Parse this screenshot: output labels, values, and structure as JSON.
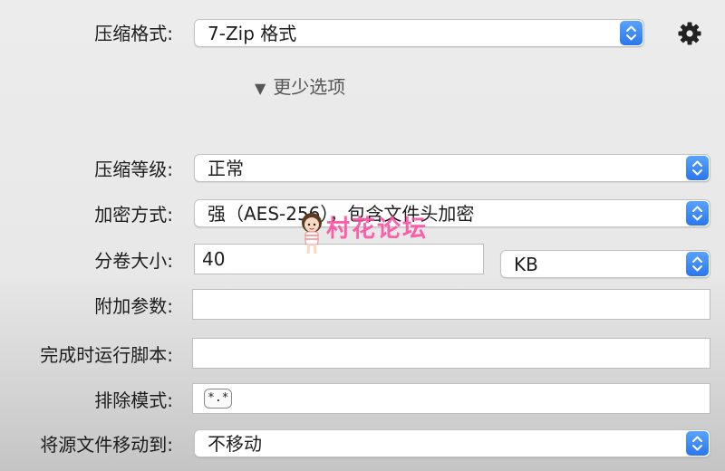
{
  "format": {
    "label": "压缩格式:",
    "value": "7-Zip 格式"
  },
  "settings_icon": "gear-icon",
  "disclosure": {
    "label": "更少选项",
    "icon": "triangle-down-icon"
  },
  "level": {
    "label": "压缩等级:",
    "value": "正常"
  },
  "encryption": {
    "label": "加密方式:",
    "value": "强（AES-256），包含文件头加密"
  },
  "split": {
    "label": "分卷大小:",
    "value": "40",
    "unit": "KB"
  },
  "extra_params": {
    "label": "附加参数:",
    "value": ""
  },
  "post_script": {
    "label": "完成时运行脚本:",
    "value": ""
  },
  "exclude": {
    "label": "排除模式:",
    "tokens": [
      "*.*"
    ]
  },
  "move_source": {
    "label": "将源文件移动到:",
    "value": "不移动"
  },
  "watermark": {
    "text": "村花论坛"
  },
  "colors": {
    "accent": "#2f7df0",
    "watermark": "#ff4fa3",
    "gear": "#222222"
  }
}
